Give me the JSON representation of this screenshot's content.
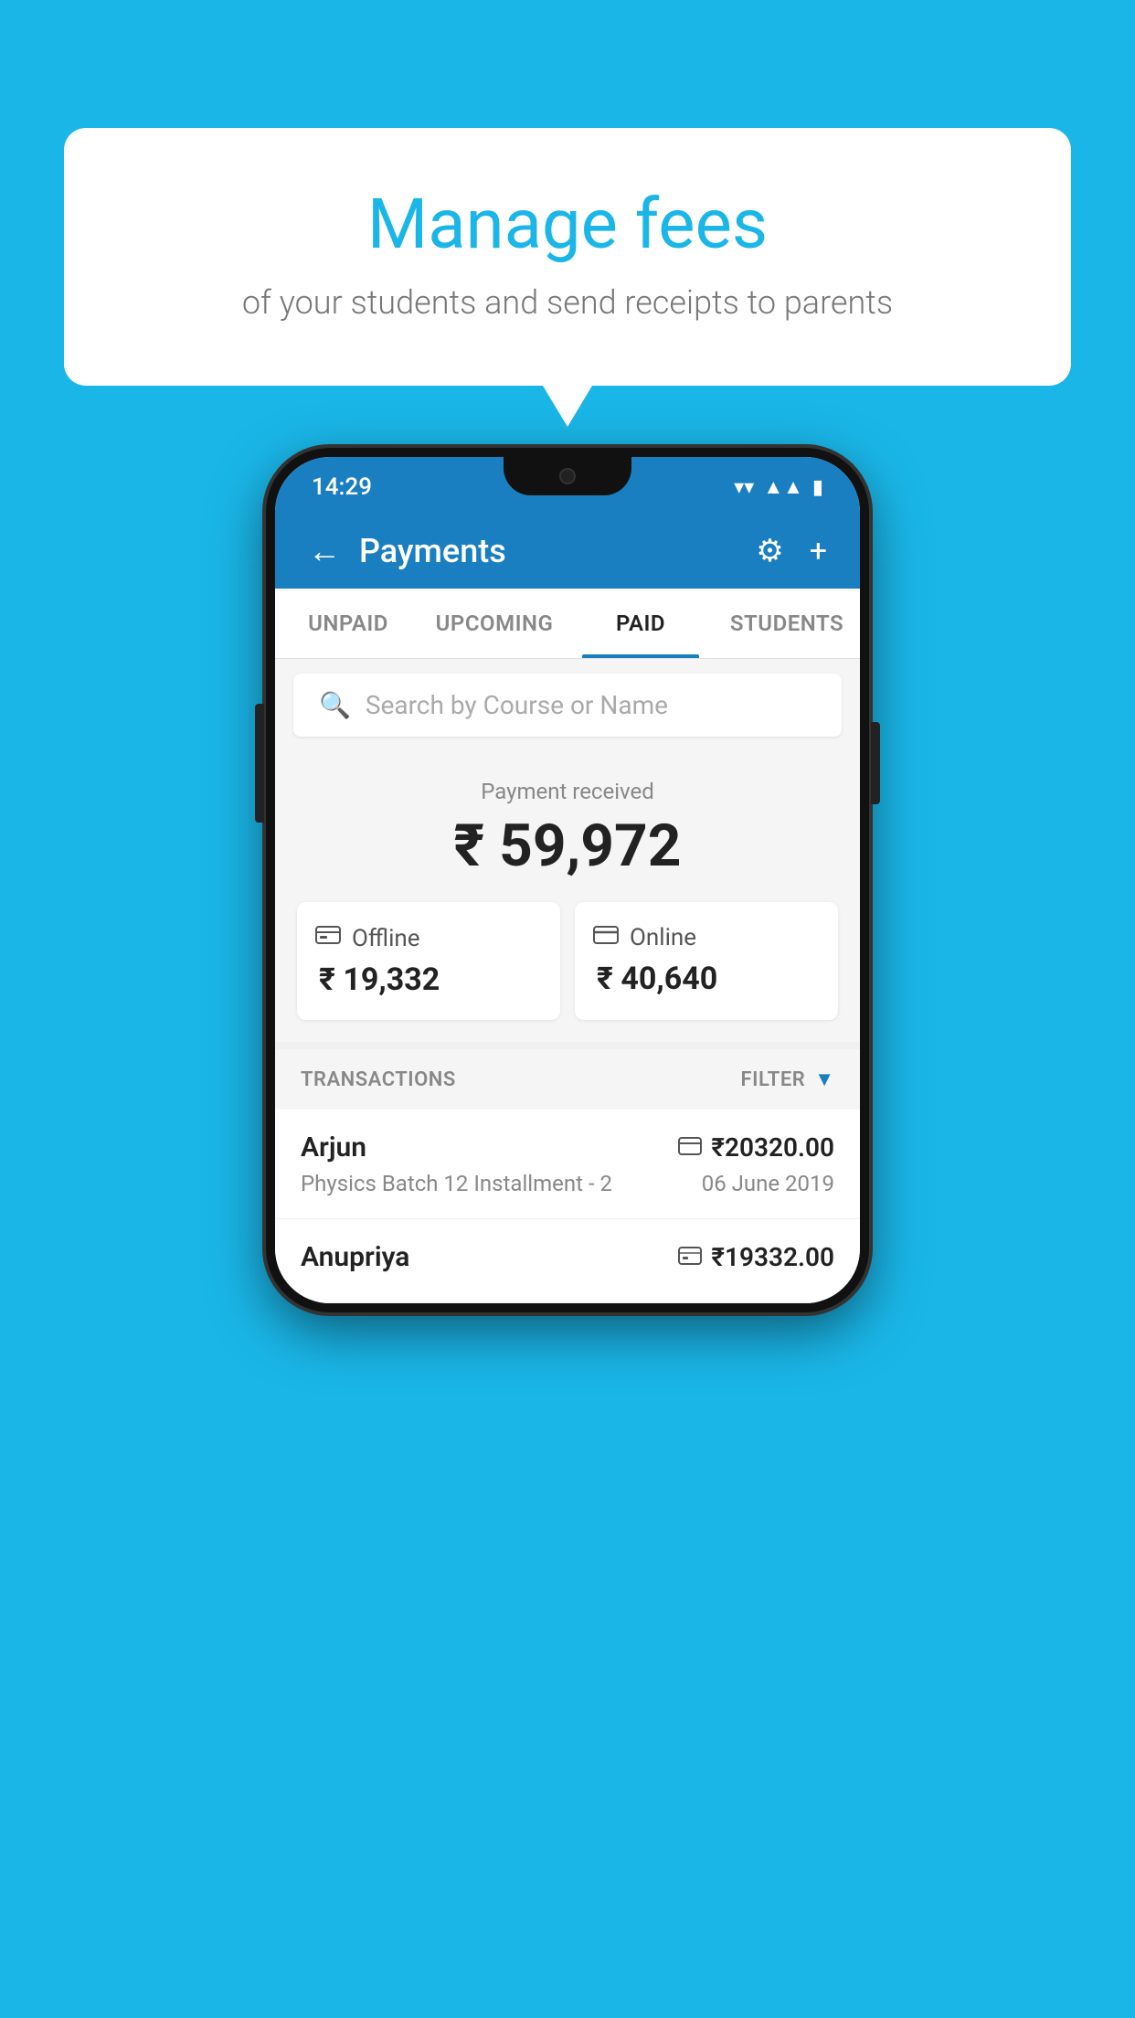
{
  "background_color": "#1ab6e8",
  "bubble": {
    "title": "Manage fees",
    "subtitle": "of your students and send receipts to parents"
  },
  "status_bar": {
    "time": "14:29",
    "wifi": "▼",
    "signal": "▲",
    "battery": "▮"
  },
  "header": {
    "title": "Payments",
    "back_label": "←",
    "gear_label": "⚙",
    "plus_label": "+"
  },
  "tabs": [
    {
      "label": "UNPAID",
      "active": false
    },
    {
      "label": "UPCOMING",
      "active": false
    },
    {
      "label": "PAID",
      "active": true
    },
    {
      "label": "STUDENTS",
      "active": false
    }
  ],
  "search": {
    "placeholder": "Search by Course or Name"
  },
  "payment_summary": {
    "label": "Payment received",
    "total": "₹ 59,972",
    "offline": {
      "icon": "offline",
      "label": "Offline",
      "amount": "₹ 19,332"
    },
    "online": {
      "icon": "online",
      "label": "Online",
      "amount": "₹ 40,640"
    }
  },
  "transactions_header": {
    "label": "TRANSACTIONS",
    "filter_label": "FILTER"
  },
  "transactions": [
    {
      "name": "Arjun",
      "course": "Physics Batch 12 Installment - 2",
      "amount": "₹20320.00",
      "date": "06 June 2019",
      "icon": "card"
    },
    {
      "name": "Anupriya",
      "course": "",
      "amount": "₹19332.00",
      "date": "",
      "icon": "cash"
    }
  ]
}
